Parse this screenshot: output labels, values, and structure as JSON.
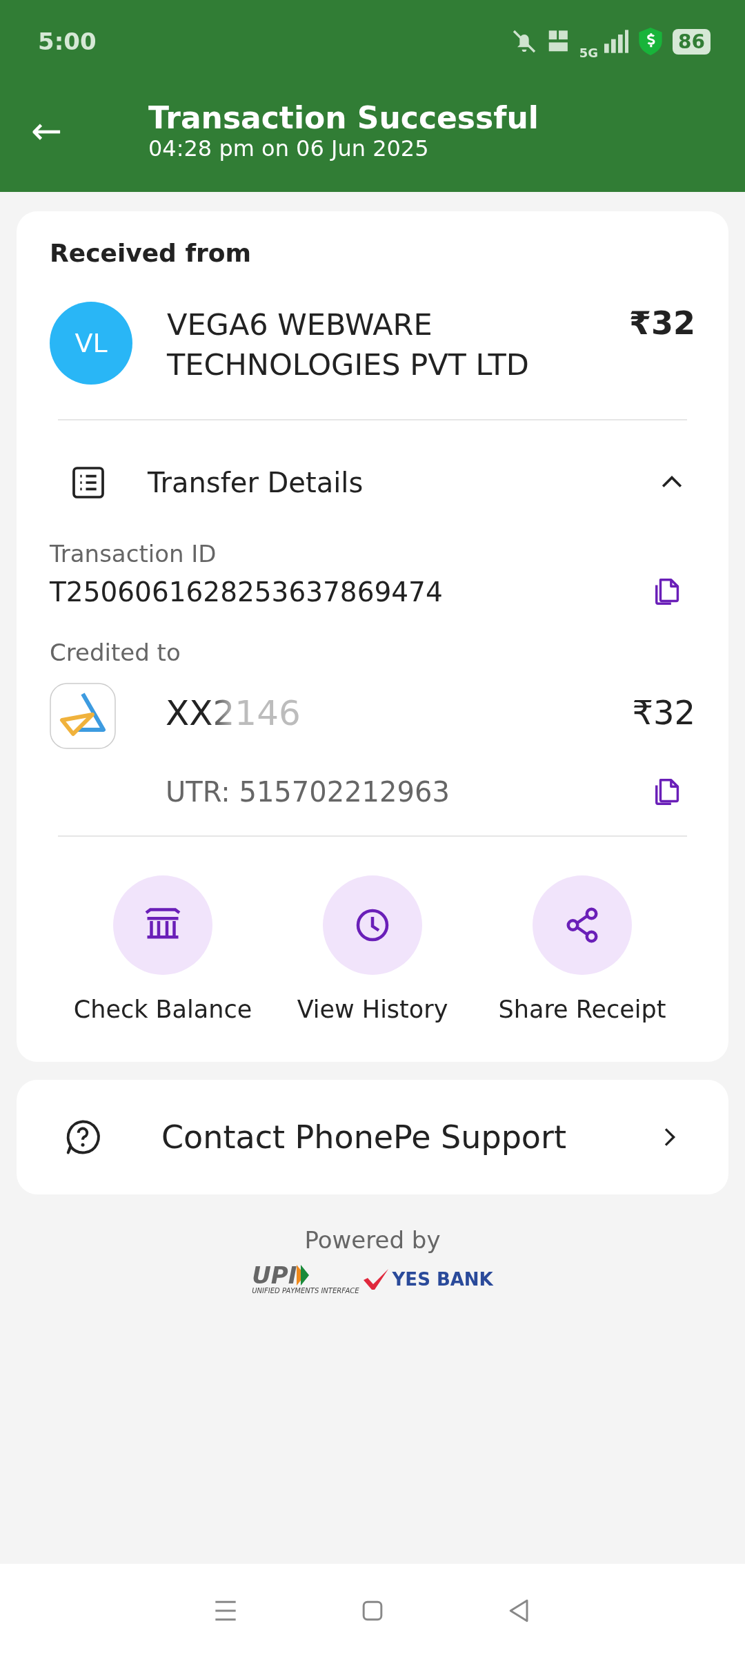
{
  "status_bar": {
    "time": "5:00",
    "battery": "86",
    "network": "5G"
  },
  "header": {
    "back": "←",
    "title": "Transaction Successful",
    "subtitle": "04:28 pm on 06 Jun 2025"
  },
  "received": {
    "heading": "Received from",
    "avatar": "VL",
    "name": "VEGA6 WEBWARE TECHNOLOGIES PVT LTD",
    "amount": "₹32"
  },
  "transfer_details": {
    "title": "Transfer Details",
    "expanded": true,
    "transaction_id_label": "Transaction ID",
    "transaction_id": "T2506061628253637869474",
    "credited_label": "Credited to",
    "account": "XX2146",
    "account_amount": "₹32",
    "utr": "UTR: 515702212963"
  },
  "actions": [
    {
      "kind": "bank",
      "label": "Check Balance"
    },
    {
      "kind": "clock",
      "label": "View History"
    },
    {
      "kind": "share",
      "label": "Share Receipt"
    }
  ],
  "support": {
    "label": "Contact PhonePe Support"
  },
  "footer": {
    "powered_by": "Powered by",
    "upi": "UPI",
    "upi_sub": "UNIFIED PAYMENTS INTERFACE",
    "bank": "YES BANK"
  }
}
